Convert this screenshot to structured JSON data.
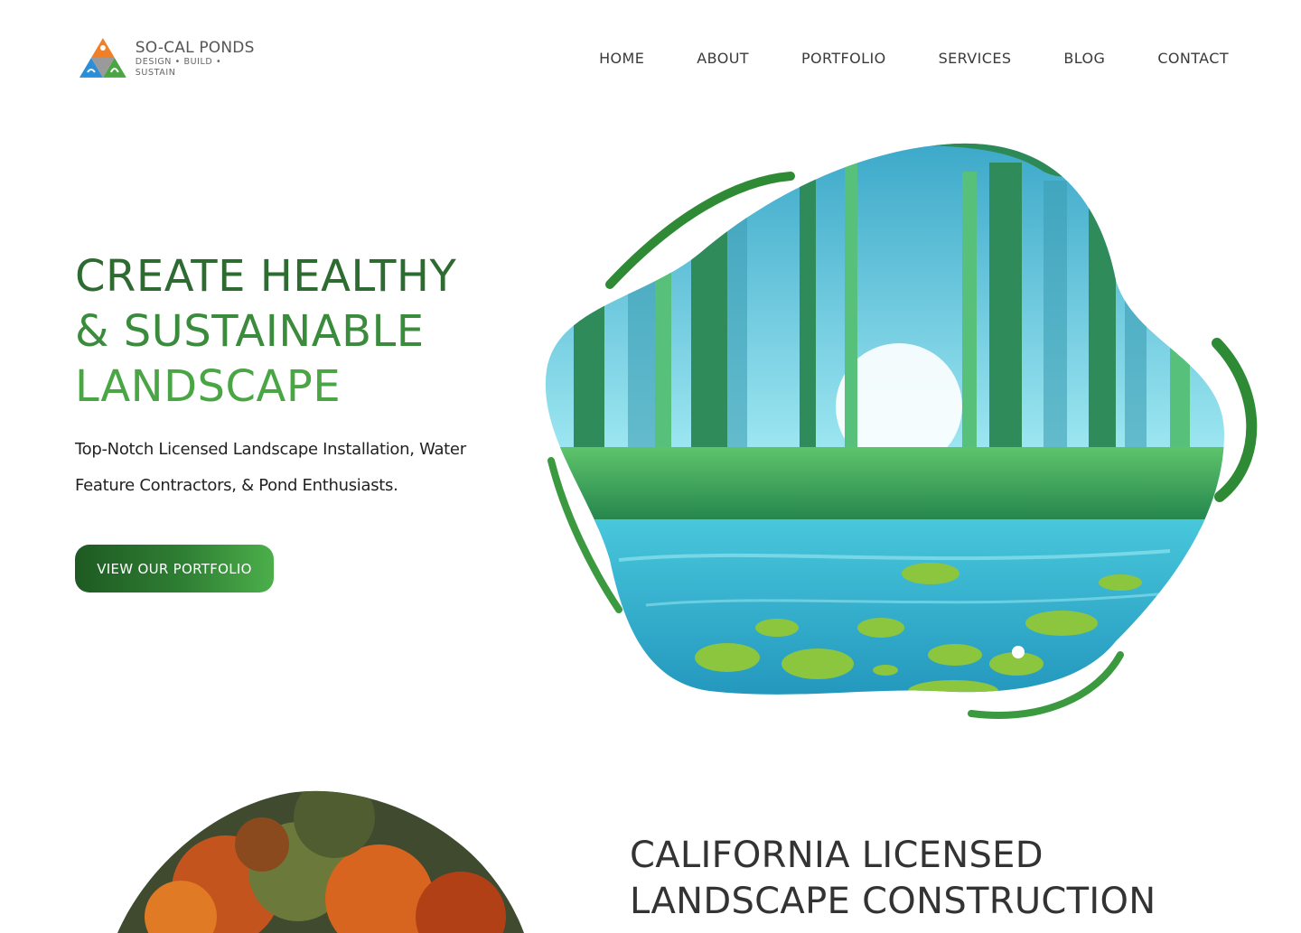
{
  "brand": {
    "name": "SO-CAL PONDS",
    "tagline": "DESIGN • BUILD • SUSTAIN",
    "colors": {
      "orange": "#f07f2a",
      "blue": "#2a8fd6",
      "green": "#4aa544",
      "gray": "#8a8a8a"
    }
  },
  "nav": {
    "items": [
      "HOME",
      "ABOUT",
      "PORTFOLIO",
      "SERVICES",
      "BLOG",
      "CONTACT"
    ]
  },
  "hero": {
    "title_line1": "CREATE HEALTHY",
    "title_line2": "& SUSTAINABLE",
    "title_line3": "LANDSCAPE",
    "subtitle": "Top-Notch Licensed Landscape Installation, Water Feature Contractors, & Pond Enthusiasts.",
    "cta_label": "VIEW OUR PORTFOLIO"
  },
  "section2": {
    "title_line1": "CALIFORNIA LICENSED",
    "title_line2": "LANDSCAPE CONSTRUCTION"
  },
  "theme": {
    "dark_green": "#2e6b30",
    "mid_green": "#3b8b3d",
    "light_green": "#4aa544",
    "water": "#3fb6d6"
  }
}
